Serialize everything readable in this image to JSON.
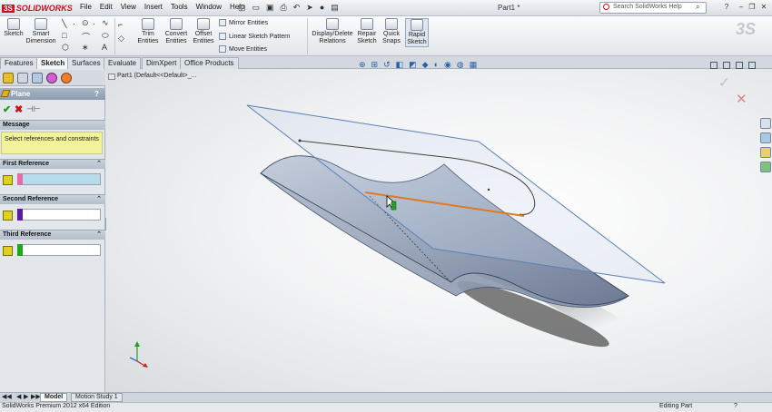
{
  "app": {
    "logo": "SOLIDWORKS",
    "doc_title": "Part1 *"
  },
  "menu": [
    "File",
    "Edit",
    "View",
    "Insert",
    "Tools",
    "Window",
    "Help"
  ],
  "search": {
    "placeholder": "Search SolidWorks Help"
  },
  "commands": {
    "sketch": "Sketch",
    "smart_dimension": "Smart Dimension",
    "trim_entities": "Trim Entities",
    "convert_entities": "Convert Entities",
    "offset_entities": "Offset Entities",
    "mirror_entities": "Mirror Entities",
    "linear_sketch_pattern": "Linear Sketch Pattern",
    "move_entities": "Move Entities",
    "display_delete_relations": "Display/Delete Relations",
    "repair_sketch": "Repair Sketch",
    "quick_snaps": "Quick Snaps",
    "rapid_sketch": "Rapid Sketch"
  },
  "tabs": [
    "Features",
    "Sketch",
    "Surfaces",
    "Evaluate",
    "DimXpert",
    "Office Products"
  ],
  "active_tab": "Sketch",
  "property_manager": {
    "title": "Plane",
    "help": "?",
    "message_header": "Message",
    "message": "Select references and constraints",
    "first_reference": "First Reference",
    "second_reference": "Second Reference",
    "third_reference": "Third Reference"
  },
  "tree": {
    "root": "Part1  (Default<<Default>_..."
  },
  "bottom_tabs": [
    "Model",
    "Motion Study 1"
  ],
  "status": {
    "left": "SolidWorks Premium 2012 x64 Edition",
    "right": "Editing Part"
  },
  "colors": {
    "ref1": "#e86aa8",
    "ref2": "#5a1aa8",
    "ref3": "#18a818",
    "accent_red": "#c8101e"
  }
}
